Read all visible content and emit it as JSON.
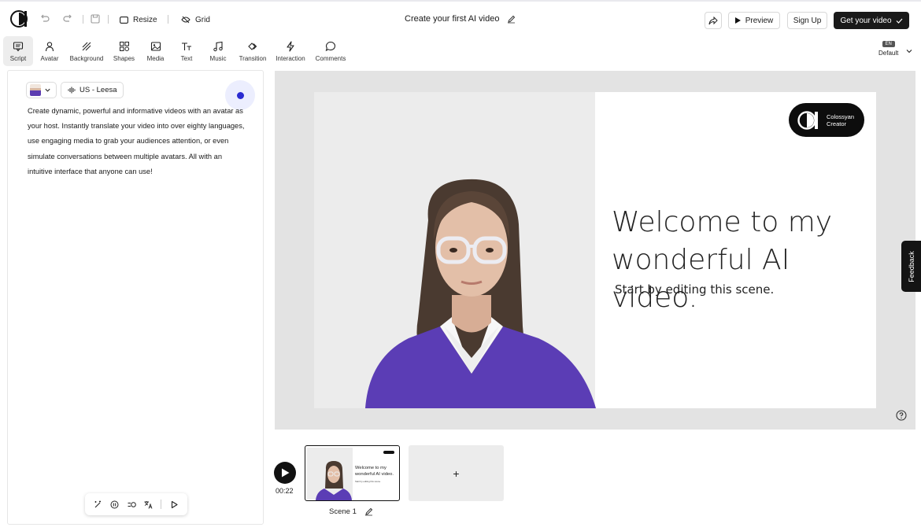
{
  "header": {
    "resize_label": "Resize",
    "grid_label": "Grid",
    "title": "Create your first AI video",
    "preview_label": "Preview",
    "signup_label": "Sign Up",
    "get_video_label": "Get your video"
  },
  "tools": [
    {
      "label": "Script",
      "icon": "script-icon",
      "active": true
    },
    {
      "label": "Avatar",
      "icon": "avatar-icon"
    },
    {
      "label": "Background",
      "icon": "background-icon"
    },
    {
      "label": "Shapes",
      "icon": "shapes-icon"
    },
    {
      "label": "Media",
      "icon": "media-icon"
    },
    {
      "label": "Text",
      "icon": "text-icon"
    },
    {
      "label": "Music",
      "icon": "music-icon"
    },
    {
      "label": "Transition",
      "icon": "transition-icon"
    },
    {
      "label": "Interaction",
      "icon": "interaction-icon"
    },
    {
      "label": "Comments",
      "icon": "comments-icon"
    }
  ],
  "language": {
    "code": "EN",
    "label": "Default"
  },
  "script": {
    "voice_label": "US - Leesa",
    "text": "Create dynamic, powerful and informative videos with an avatar as your host. Instantly translate your video into over eighty languages, use engaging media to grab your audiences attention, or even simulate conversations between multiple avatars. All with an intuitive interface that anyone can use!"
  },
  "slide": {
    "brand_line1": "Colossyan",
    "brand_line2": "Creator",
    "title_line1": "Welcome to my",
    "title_line2": "wonderful AI video.",
    "subtitle": "Start by editing this scene."
  },
  "feedback_label": "Feedback",
  "timeline": {
    "duration": "00:22",
    "scene_label": "Scene 1",
    "thumb_title": "Welcome to my wonderful AI video.",
    "thumb_sub": "Start by editing this scene.",
    "add_label": "+"
  },
  "colors": {
    "accent": "#2b2bd1",
    "avatar_sweater": "#5b3db5",
    "dark": "#111111"
  }
}
